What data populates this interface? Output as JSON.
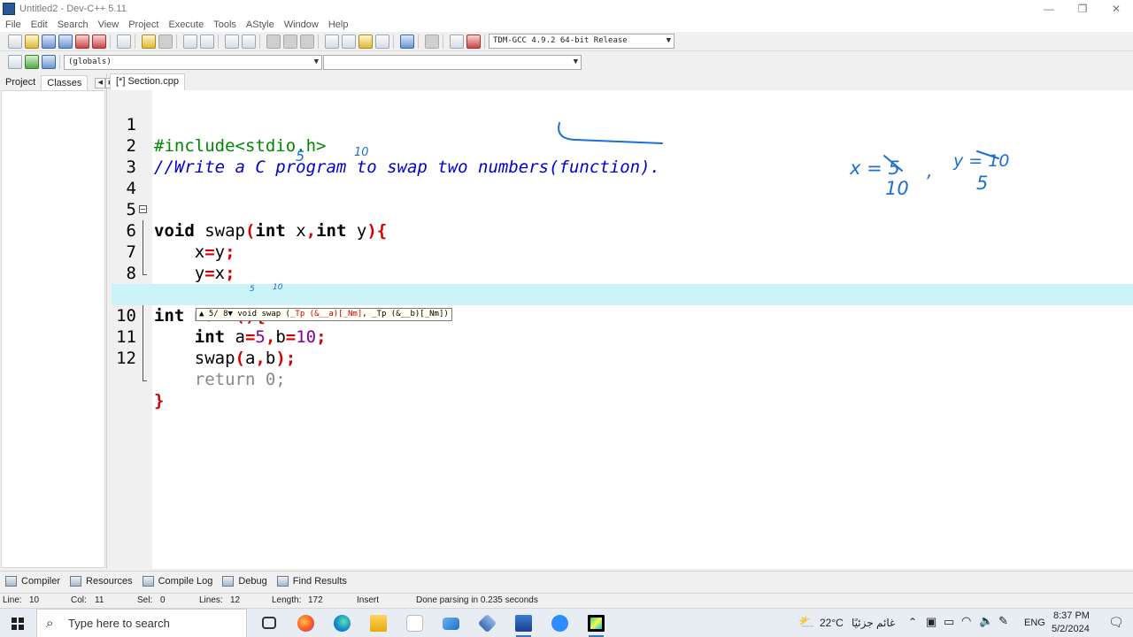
{
  "window": {
    "title": "Untitled2 - Dev-C++ 5.11",
    "min": "—",
    "max": "❐",
    "close": "✕"
  },
  "menu": [
    "File",
    "Edit",
    "Search",
    "View",
    "Project",
    "Execute",
    "Tools",
    "AStyle",
    "Window",
    "Help"
  ],
  "toolbar": {
    "compiler": "TDM-GCC 4.9.2 64-bit Release",
    "scope": "(globals)",
    "symbol": ""
  },
  "left_panel": {
    "tabs": [
      "Project",
      "Classes"
    ],
    "prev": "◀",
    "next": "▶"
  },
  "editor": {
    "tab": "[*] Section.cpp",
    "current_line": 10,
    "lines": [
      {
        "n": "1"
      },
      {
        "n": "2"
      },
      {
        "n": "3"
      },
      {
        "n": "4"
      },
      {
        "n": "5"
      },
      {
        "n": "6"
      },
      {
        "n": "7"
      },
      {
        "n": "8"
      },
      {
        "n": "9"
      },
      {
        "n": "10"
      },
      {
        "n": "11"
      },
      {
        "n": "12"
      }
    ],
    "code": {
      "l1": "#include<stdio.h>",
      "l2": "//Write a C program to swap two numbers(function).",
      "l4_kw1": "void",
      "l4_fn": " swap",
      "l4_p1": "(",
      "l4_kw2": "int",
      "l4_x": " x",
      "l4_c": ",",
      "l4_kw3": "int",
      "l4_y": " y",
      "l4_p2": "){",
      "l5_a": "    x",
      "l5_eq": "=",
      "l5_b": "y",
      "l5_s": ";",
      "l6_a": "    y",
      "l6_eq": "=",
      "l6_b": "x",
      "l6_s": ";",
      "l7": "}",
      "l8_kw": "int",
      "l8_fn": " main",
      "l8_p": "(){",
      "l9_kw": "    int",
      "l9_a": " a",
      "l9_eq1": "=",
      "l9_n1": "5",
      "l9_c": ",",
      "l9_b": "b",
      "l9_eq2": "=",
      "l9_n2": "10",
      "l9_s": ";",
      "l10_fn": "    swap",
      "l10_p1": "(",
      "l10_a": "a",
      "l10_c": ",",
      "l10_b": "b",
      "l10_p2": ");",
      "l11": "    return 0;",
      "l12": "}"
    },
    "tooltip": {
      "counter": "5/ 8",
      "sig_pre": "void swap (",
      "sig_hl": "_Tp (&__a)[_Nm]",
      "sig_post": ", _Tp (&__b)[_Nm])"
    }
  },
  "annotations": {
    "over_x": "5",
    "over_y": "10",
    "side_x": "x = 5",
    "side_x_new": "10",
    "side_comma": ",",
    "side_y": "y = 10",
    "side_y_new": "5",
    "over_a": "5",
    "over_b": "10",
    "ink_color": "#1c6fd6"
  },
  "bottom_tabs": [
    "Compiler",
    "Resources",
    "Compile Log",
    "Debug",
    "Find Results"
  ],
  "status": {
    "line_label": "Line:",
    "line": "10",
    "col_label": "Col:",
    "col": "11",
    "sel_label": "Sel:",
    "sel": "0",
    "lines_label": "Lines:",
    "lines": "12",
    "length_label": "Length:",
    "length": "172",
    "mode": "Insert",
    "message": "Done parsing in 0.235 seconds"
  },
  "taskbar": {
    "search_placeholder": "Type here to search",
    "weather": "22°C",
    "weather_text": "غائم جزئيًا",
    "lang": "ENG",
    "time": "8:37 PM",
    "date": "5/2/2024"
  }
}
